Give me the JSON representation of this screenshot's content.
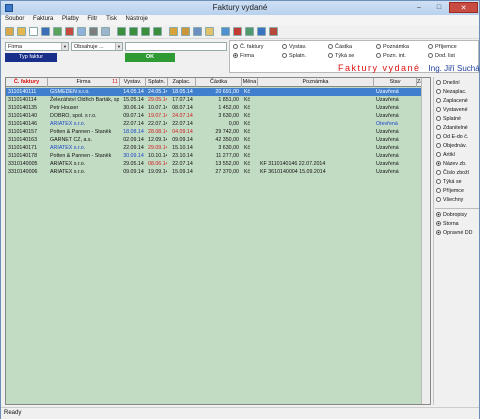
{
  "window": {
    "title": "Faktury vydané",
    "min_glyph": "–",
    "max_glyph": "□",
    "close_glyph": "✕"
  },
  "menu": [
    "Soubor",
    "Faktura",
    "Platby",
    "Filtr",
    "Tisk",
    "Nástroje"
  ],
  "toolbar_icons": [
    {
      "name": "open-icon",
      "color": "#d9a64a"
    },
    {
      "name": "folder-icon",
      "color": "#e3b84f"
    },
    {
      "name": "new-icon",
      "color": "#ffffff"
    },
    {
      "name": "save-icon",
      "color": "#3d6fb8"
    },
    {
      "name": "edit-icon",
      "color": "#5aa35a"
    },
    {
      "name": "delete-icon",
      "color": "#c64a3d"
    },
    {
      "name": "copy-icon",
      "color": "#8fb0d8"
    },
    {
      "name": "print-icon",
      "color": "#7d7d7d"
    },
    {
      "name": "preview-icon",
      "color": "#9db4cf"
    },
    {
      "name": "first-icon",
      "color": "#3b8e3b"
    },
    {
      "name": "prev-icon",
      "color": "#3b8e3b"
    },
    {
      "name": "next-icon",
      "color": "#3b8e3b"
    },
    {
      "name": "last-icon",
      "color": "#3b8e3b"
    },
    {
      "name": "filter-icon",
      "color": "#d4a43b"
    },
    {
      "name": "percent-icon",
      "color": "#c9973a"
    },
    {
      "name": "calc-icon",
      "color": "#6e8fc4"
    },
    {
      "name": "mail-icon",
      "color": "#e1c26a"
    },
    {
      "name": "chart-icon",
      "color": "#4f90d0"
    },
    {
      "name": "pdf-icon",
      "color": "#c33c33"
    },
    {
      "name": "export-icon",
      "color": "#4f9a6c"
    },
    {
      "name": "help-icon",
      "color": "#3a73c2"
    },
    {
      "name": "exit-icon",
      "color": "#b54a3a"
    }
  ],
  "filter": {
    "field": "Firma",
    "operator": "Obsahuje ...",
    "value": "",
    "typ_button": "Typ faktur",
    "ok_button": "OK"
  },
  "sort_options": [
    {
      "label": "Č. faktury",
      "checked": false
    },
    {
      "label": "Firma",
      "checked": true
    },
    {
      "label": "Vystav.",
      "checked": false
    },
    {
      "label": "Splatn.",
      "checked": false
    },
    {
      "label": "Částka",
      "checked": false
    },
    {
      "label": "Týká se",
      "checked": false
    },
    {
      "label": "Poznámka",
      "checked": false
    },
    {
      "label": "Pozn. int.",
      "checked": false
    },
    {
      "label": "Příjemce",
      "checked": false
    },
    {
      "label": "Dod. list",
      "checked": false
    }
  ],
  "banner": {
    "title": "Faktury vydané",
    "author": "Ing. Jiří Suchánek"
  },
  "grid": {
    "columns": [
      "Č. faktury",
      "Firma",
      "Vystav.",
      "Splatn.",
      "Zaplac.",
      "Částka",
      "Měna",
      "Poznámka",
      "Stav",
      "Zam"
    ],
    "sort_marker": "11",
    "rows": [
      {
        "c": [
          "3110140111",
          "GSMEDEN s.r.o.",
          "14.05.14",
          "24.05.14",
          "18.05.14",
          "20 691,00",
          "Kč",
          "",
          "Uzavřená",
          ""
        ],
        "sel": true
      },
      {
        "c": [
          "3110140114",
          "Železářství Oldřich Barták, spol.",
          "15.05.14",
          "29.05.14",
          "17.07.14",
          "1 851,00",
          "Kč",
          "",
          "Uzavřená",
          ""
        ]
      },
      {
        "c": [
          "3110140135",
          "Petr Houser",
          "30.06.14",
          "10.07.14",
          "08.07.14",
          "1 452,00",
          "Kč",
          "",
          "Uzavřená",
          ""
        ]
      },
      {
        "c": [
          "3110140140",
          "DOBRO, spol. s r.o.",
          "09.07.14",
          "19.07.14",
          "24.07.14",
          "3 630,00",
          "Kč",
          "",
          "Uzavřená",
          ""
        ]
      },
      {
        "c": [
          "3110140146",
          "ARIATEX s.r.o.",
          "22.07.14",
          "22.07.14",
          "22.07.14",
          "0,00",
          "Kč",
          "",
          "Otevřená",
          ""
        ]
      },
      {
        "c": [
          "3110140157",
          "Potten & Pannen - Staněk",
          "18.08.14",
          "28.08.14",
          "04.09.14",
          "29 742,00",
          "Kč",
          "",
          "Uzavřená",
          ""
        ]
      },
      {
        "c": [
          "3110140163",
          "GARNET CZ, a.s.",
          "02.09.14",
          "12.09.14",
          "09.09.14",
          "42 350,00",
          "Kč",
          "",
          "Uzavřená",
          ""
        ]
      },
      {
        "c": [
          "3110140171",
          "ARIATEX s.r.o.",
          "22.09.14",
          "29.09.14",
          "15.10.14",
          "3 630,00",
          "Kč",
          "",
          "Uzavřená",
          ""
        ]
      },
      {
        "c": [
          "3110140178",
          "Potten & Pannen - Staněk",
          "30.09.14",
          "10.10.14",
          "23.10.14",
          "11 277,00",
          "Kč",
          "",
          "Uzavřená",
          ""
        ]
      },
      {
        "c": [
          "3310140005",
          "ARIATEX s.r.o.",
          "29.05.14",
          "08.06.14",
          "22.07.14",
          "13 552,00",
          "Kč",
          "KF 3110140146 22.07.2014",
          "Uzavřená",
          ""
        ]
      },
      {
        "c": [
          "3310140006",
          "ARIATEX s.r.o.",
          "09.09.14",
          "19.09.14",
          "15.09.14",
          "27 370,00",
          "Kč",
          "KF 3610140004 15.09.2014",
          "Uzavřená",
          ""
        ]
      }
    ]
  },
  "side_panel": {
    "radios": [
      {
        "label": "Dnešní",
        "checked": false
      },
      {
        "label": "Nezaplac.",
        "checked": false
      },
      {
        "label": "Zaplacené",
        "checked": false
      },
      {
        "label": "Vystavené",
        "checked": false
      },
      {
        "label": "Splatné",
        "checked": false
      },
      {
        "label": "Zdanitelné",
        "checked": false
      },
      {
        "label": "Od E-do č.",
        "checked": false
      },
      {
        "label": "Objednáv.",
        "checked": false
      },
      {
        "label": "Artikl",
        "checked": false
      },
      {
        "label": "Název zb.",
        "checked": true
      },
      {
        "label": "Číslo zboží",
        "checked": false
      },
      {
        "label": "Týká se",
        "checked": false
      },
      {
        "label": "Příjemce",
        "checked": false
      },
      {
        "label": "Všechny",
        "checked": false
      }
    ],
    "checks": [
      {
        "label": "Dobropisy",
        "checked": true
      },
      {
        "label": "Storna",
        "checked": true
      },
      {
        "label": "Opravné DD",
        "checked": true
      }
    ]
  },
  "status": "Ready",
  "colors": {
    "late": "#d01a1a",
    "blue_date": "#1b46c8",
    "open_status": "#1b46c8"
  }
}
